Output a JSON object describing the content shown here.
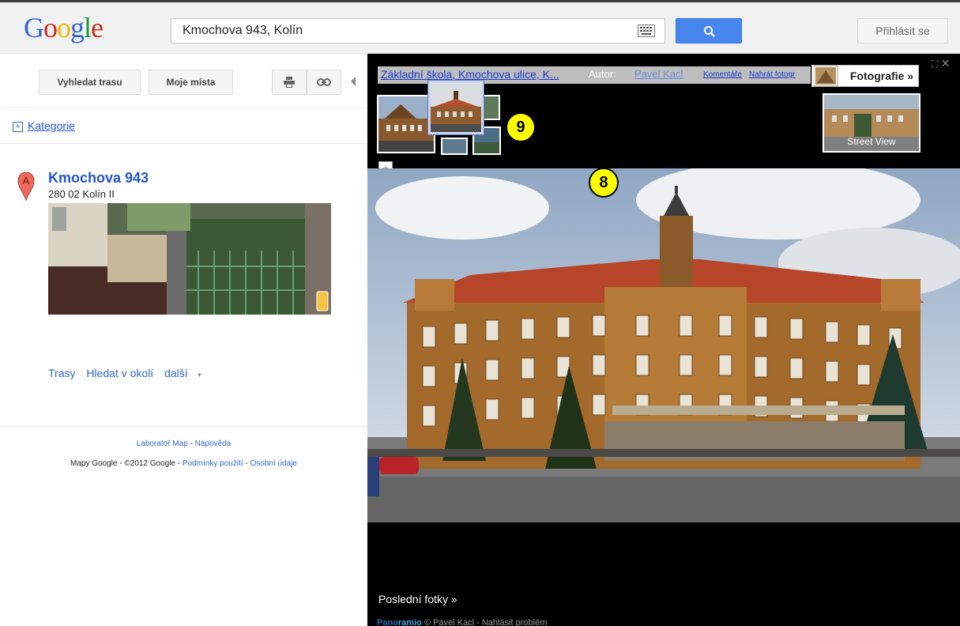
{
  "header": {
    "logo_letters": [
      "G",
      "o",
      "o",
      "g",
      "l",
      "e"
    ],
    "logo_colors": [
      "#3366cc",
      "#cc2b1e",
      "#f2b400",
      "#3366cc",
      "#119f35",
      "#cc2b1e"
    ],
    "search_value": "Kmochova 943, Kolín",
    "signin_label": "Přihlásit se",
    "keyboard_icon": "keyboard-icon",
    "search_icon": "search-icon"
  },
  "sidebar": {
    "route_button": "Vyhledat trasu",
    "my_places_button": "Moje místa",
    "print_icon": "print-icon",
    "link_icon": "link-icon",
    "collapse_icon": "collapse-arrow-icon",
    "categories_label": "Kategorie",
    "place": {
      "marker_letter": "A",
      "title": "Kmochova 943",
      "address": "280 02 Kolín II"
    },
    "actions": [
      "Trasy",
      "Hledat v okolí",
      "další"
    ],
    "footer": {
      "labs": "Laboratoř Map",
      "help": "Nápověda",
      "copyright": "Mapy Google - ©2012 Google",
      "terms": "Podmínky použití",
      "privacy": "Osobní údaje"
    }
  },
  "photo_viewer": {
    "title": "Základní škola, Kmochova ulice, K...",
    "author_label": "Autor:",
    "author": "Pavel Kacl",
    "comments_link": "Komentáře",
    "upload_link": "Nahrát fotogr",
    "photos_button": "Fotografie »",
    "street_view_label": "Street View",
    "badge_9": "9",
    "badge_8": "8",
    "zoom_in": "+",
    "zoom_out": "−",
    "recent_label": "Poslední fotky »",
    "credit_logo_a": "Pano",
    "credit_logo_b": "ramio",
    "credit_text": "© Pavel Kacl - Nahlásit problém"
  },
  "colors": {
    "accent": "#4787ed",
    "link": "#3366cc",
    "badge": "#ffff00"
  }
}
